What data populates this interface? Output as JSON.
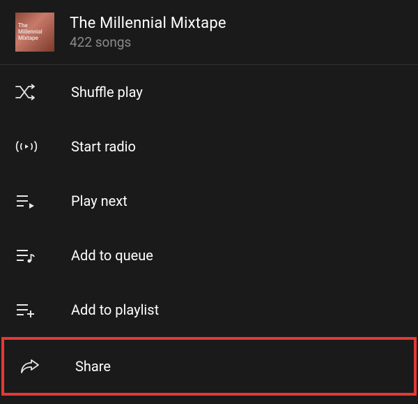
{
  "header": {
    "title": "The Millennial Mixtape",
    "subtitle": "422 songs",
    "album_overlay_line1": "The",
    "album_overlay_line2": "Millennial",
    "album_overlay_line3": "Mixtape"
  },
  "menu": {
    "shuffle": "Shuffle play",
    "radio": "Start radio",
    "play_next": "Play next",
    "add_queue": "Add to queue",
    "add_playlist": "Add to playlist",
    "share": "Share"
  }
}
